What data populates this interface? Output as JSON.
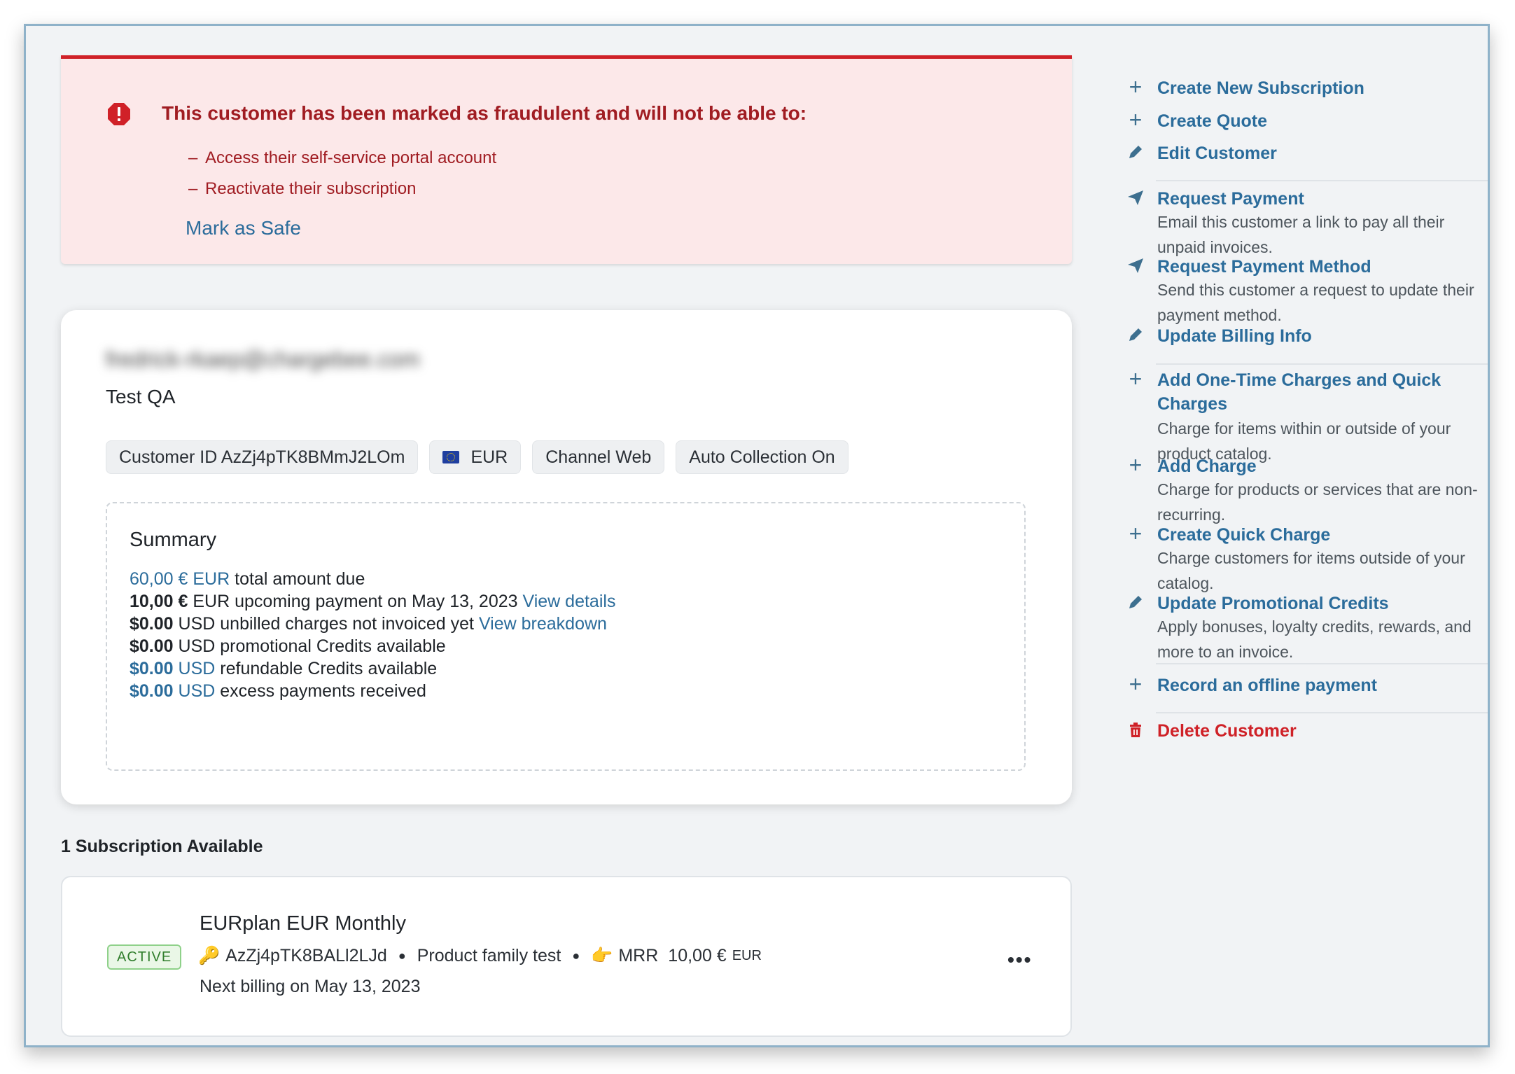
{
  "alert": {
    "title": "This customer has been marked as fraudulent and will not be able to:",
    "items": [
      "Access their self-service portal account",
      "Reactivate their subscription"
    ],
    "dash": "–",
    "action_label": "Mark as Safe"
  },
  "customer": {
    "email": "fredrick-rkaep@chargebee.com",
    "name": "Test QA",
    "pills": {
      "customer_id": "Customer ID AzZj4pTK8BMmJ2LOm",
      "currency": "EUR",
      "channel": "Channel Web",
      "auto_collection": "Auto Collection On"
    }
  },
  "summary": {
    "title": "Summary",
    "rows": [
      {
        "amount": "60,00 €",
        "currency": "EUR",
        "text": "total amount due"
      },
      {
        "amount": "10,00 €",
        "currency": "EUR",
        "text": "upcoming payment on May 13, 2023",
        "link": "View details"
      },
      {
        "amount": "$0.00",
        "currency": "USD",
        "text": "unbilled charges not invoiced yet",
        "link": "View breakdown"
      },
      {
        "amount": "$0.00",
        "currency": "USD",
        "text": "promotional Credits available"
      },
      {
        "amount": "$0.00",
        "currency": "USD",
        "text": "refundable Credits available"
      },
      {
        "amount": "$0.00",
        "currency": "USD",
        "text": "excess payments received"
      }
    ]
  },
  "subscriptions": {
    "heading": "1 Subscription Available",
    "items": [
      {
        "status": "ACTIVE",
        "plan": "EURplan EUR Monthly",
        "id": "AzZj4pTK8BALl2LJd",
        "family": "Product family test",
        "mrr_label": "MRR",
        "mrr_value": "10,00 €",
        "mrr_currency": "EUR",
        "next_billing": "Next billing on May 13, 2023",
        "more": "•••"
      }
    ]
  },
  "actions": [
    {
      "icon": "plus-icon",
      "title": "Create New Subscription"
    },
    {
      "icon": "plus-icon",
      "title": "Create Quote"
    },
    {
      "icon": "pencil-icon",
      "title": "Edit Customer"
    },
    {
      "icon": "send-icon",
      "title": "Request Payment",
      "desc": "Email this customer a link to pay all their unpaid invoices."
    },
    {
      "icon": "send-icon",
      "title": "Request Payment Method",
      "desc": "Send this customer a request to update their payment method."
    },
    {
      "icon": "pencil-icon",
      "title": "Update Billing Info"
    },
    {
      "icon": "plus-icon",
      "title": "Add One-Time Charges and Quick Charges",
      "desc": "Charge for items within or outside of your product catalog."
    },
    {
      "icon": "plus-icon",
      "title": "Add Charge",
      "desc": "Charge for products or services that are non-recurring."
    },
    {
      "icon": "plus-icon",
      "title": "Create Quick Charge",
      "desc": "Charge customers for items outside of your catalog."
    },
    {
      "icon": "pencil-icon",
      "title": "Update Promotional Credits",
      "desc": "Apply bonuses, loyalty credits, rewards, and more to an invoice."
    },
    {
      "icon": "plus-icon",
      "title": "Record an offline payment"
    },
    {
      "icon": "trash-icon",
      "title": "Delete Customer"
    }
  ],
  "colors": {
    "danger": "#d02128",
    "link": "#2b6c9b",
    "alert_bg": "#fce8e9",
    "active_green": "#2f7d2b"
  }
}
